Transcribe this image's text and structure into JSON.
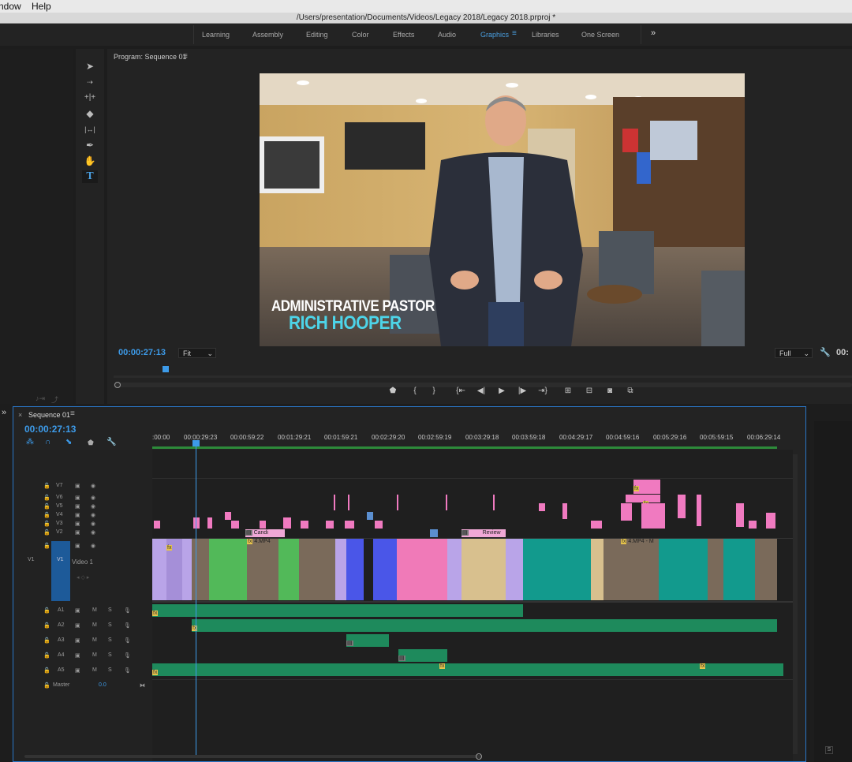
{
  "menubar": {
    "items": [
      "ndow",
      "Help"
    ]
  },
  "titlebar": {
    "path": "/Users/presentation/Documents/Videos/Legacy 2018/Legacy 2018.prproj *"
  },
  "workspaces": {
    "tabs": [
      "Learning",
      "Assembly",
      "Editing",
      "Color",
      "Effects",
      "Audio",
      "Graphics",
      "Libraries",
      "One Screen"
    ],
    "active": "Graphics",
    "overflow_icon": "double-chevron-right-icon"
  },
  "tools": [
    "selection-tool-icon",
    "track-select-icon",
    "ripple-edit-icon",
    "razor-icon",
    "slip-icon",
    "pen-icon",
    "hand-icon",
    "type-tool-icon"
  ],
  "program_monitor": {
    "title": "Program: Sequence 01",
    "timecode": "00:00:27:13",
    "fit": "Fit",
    "resolution": "Full",
    "timecode_right": "00:",
    "lower_third": {
      "line1": "ADMINISTRATIVE PASTOR",
      "line2": "RICH HOOPER"
    },
    "accent_color": "#4dd4e8"
  },
  "sequence": {
    "tab": "Sequence 01",
    "timecode": "00:00:27:13",
    "ruler": [
      ":00:00",
      "00:00:29:23",
      "00:00:59:22",
      "00:01:29:21",
      "00:01:59:21",
      "00:02:29:20",
      "00:02:59:19",
      "00:03:29:18",
      "00:03:59:18",
      "00:04:29:17",
      "00:04:59:16",
      "00:05:29:16",
      "00:05:59:15",
      "00:06:29:14"
    ],
    "video_tracks": [
      "V7",
      "V6",
      "V5",
      "V4",
      "V3",
      "V2"
    ],
    "v1": {
      "source": "V1",
      "target": "V1",
      "name": "Video 1"
    },
    "audio_tracks": [
      "A1",
      "A2",
      "A3",
      "A4",
      "A5"
    ],
    "master": {
      "label": "Master",
      "value": "0.0"
    },
    "clip_labels": {
      "candid": "Candi",
      "mp4": "4.MP4",
      "review": "Review",
      "mp4b": "4.MP4 - M"
    },
    "fx": "fx",
    "right_panel_label": "S"
  }
}
